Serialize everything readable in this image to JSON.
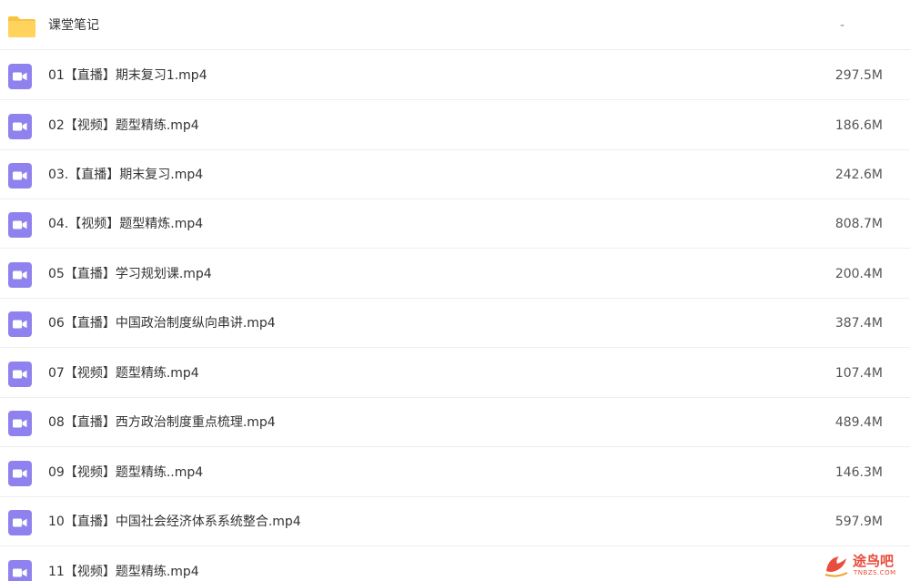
{
  "colors": {
    "folder": "#ffd35c",
    "folder_tab": "#f9c33f",
    "video_icon": "#8f82ee",
    "divider": "#eeeeee",
    "watermark": "#e84d3d"
  },
  "files": [
    {
      "type": "folder",
      "icon": "folder-icon",
      "name": "课堂笔记",
      "size": "-"
    },
    {
      "type": "video",
      "icon": "video-file-icon",
      "name": "01【直播】期末复习1.mp4",
      "size": "297.5M"
    },
    {
      "type": "video",
      "icon": "video-file-icon",
      "name": "02【视频】题型精练.mp4",
      "size": "186.6M"
    },
    {
      "type": "video",
      "icon": "video-file-icon",
      "name": "03.【直播】期末复习.mp4",
      "size": "242.6M"
    },
    {
      "type": "video",
      "icon": "video-file-icon",
      "name": "04.【视频】题型精炼.mp4",
      "size": "808.7M"
    },
    {
      "type": "video",
      "icon": "video-file-icon",
      "name": "05【直播】学习规划课.mp4",
      "size": "200.4M"
    },
    {
      "type": "video",
      "icon": "video-file-icon",
      "name": "06【直播】中国政治制度纵向串讲.mp4",
      "size": "387.4M"
    },
    {
      "type": "video",
      "icon": "video-file-icon",
      "name": "07【视频】题型精练.mp4",
      "size": "107.4M"
    },
    {
      "type": "video",
      "icon": "video-file-icon",
      "name": "08【直播】西方政治制度重点梳理.mp4",
      "size": "489.4M"
    },
    {
      "type": "video",
      "icon": "video-file-icon",
      "name": "09【视频】题型精练..mp4",
      "size": "146.3M"
    },
    {
      "type": "video",
      "icon": "video-file-icon",
      "name": "10【直播】中国社会经济体系系统整合.mp4",
      "size": "597.9M"
    },
    {
      "type": "video",
      "icon": "video-file-icon",
      "name": "11【视频】题型精练.mp4",
      "size": ""
    }
  ],
  "watermark": {
    "text": "途鸟吧",
    "sub": "TNBZS.COM"
  }
}
